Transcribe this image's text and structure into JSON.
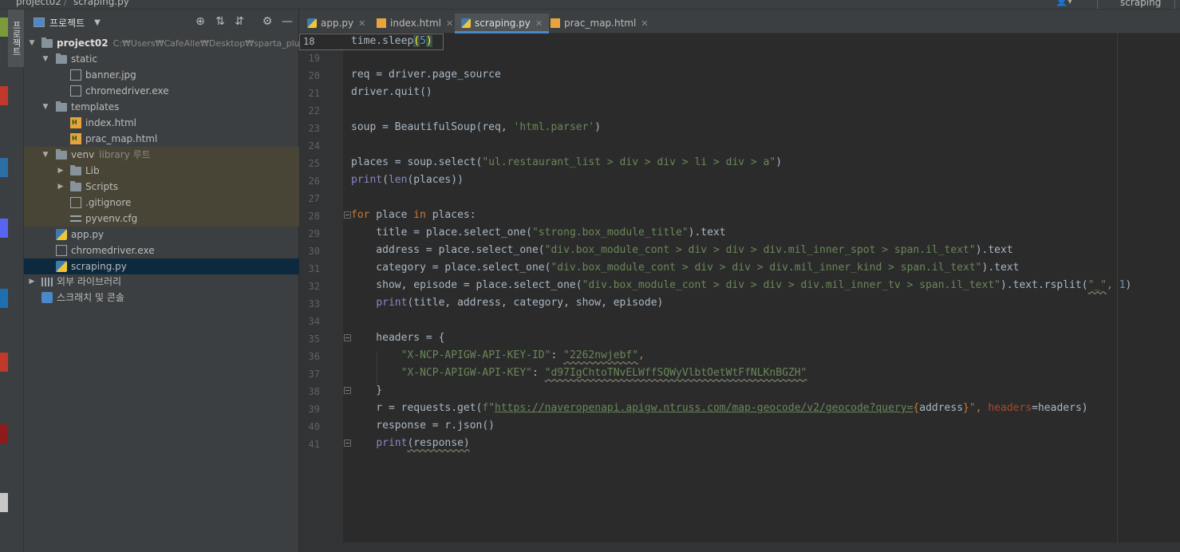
{
  "navbar": {
    "breadcrumb": [
      "project02",
      "scraping.py"
    ],
    "run_config": "scraping"
  },
  "project_panel": {
    "title": "프로젝트",
    "tree": [
      {
        "label": "project02",
        "hint": "C:₩Users₩CafeAlle₩Desktop₩sparta_plus₩pr"
      },
      {
        "label": "static"
      },
      {
        "label": "banner.jpg"
      },
      {
        "label": "chromedriver.exe"
      },
      {
        "label": "templates"
      },
      {
        "label": "index.html"
      },
      {
        "label": "prac_map.html"
      },
      {
        "label": "venv",
        "hint": "library 루트"
      },
      {
        "label": "Lib"
      },
      {
        "label": "Scripts"
      },
      {
        "label": ".gitignore"
      },
      {
        "label": "pyvenv.cfg"
      },
      {
        "label": "app.py"
      },
      {
        "label": "chromedriver.exe"
      },
      {
        "label": "scraping.py"
      },
      {
        "label": "외부 라이브러리"
      },
      {
        "label": "스크래치 및 콘솔"
      }
    ]
  },
  "tabs": [
    {
      "label": "app.py"
    },
    {
      "label": "index.html"
    },
    {
      "label": "scraping.py"
    },
    {
      "label": "prac_map.html"
    }
  ],
  "sticky": {
    "line": "18",
    "code_a": "time.sleep",
    "code_b": "(",
    "code_c": "5",
    "code_d": ")"
  },
  "line_numbers": [
    "19",
    "20",
    "21",
    "22",
    "23",
    "24",
    "25",
    "26",
    "27",
    "28",
    "29",
    "30",
    "31",
    "32",
    "33",
    "34",
    "35",
    "36",
    "37",
    "38",
    "39",
    "40",
    "41"
  ],
  "code": {
    "l20": "req = driver.page_source",
    "l21": "driver.quit()",
    "l23a": "soup = BeautifulSoup(req, ",
    "l23b": "'html.parser'",
    "l23c": ")",
    "l25a": "places = soup.select(",
    "l25b": "\"ul.restaurant_list > div > div > li > div > a\"",
    "l25c": ")",
    "l26a": "print",
    "l26b": "(",
    "l26c": "len",
    "l26d": "(places))",
    "l28a": "for",
    "l28b": " place ",
    "l28c": "in",
    "l28d": " places:",
    "l29a": "    title = place.select_one(",
    "l29b": "\"strong.box_module_title\"",
    "l29c": ").text",
    "l30a": "    address = place.select_one(",
    "l30b": "\"div.box_module_cont > div > div > div.mil_inner_spot > span.il_text\"",
    "l30c": ").text",
    "l31a": "    category = place.select_one(",
    "l31b": "\"div.box_module_cont > div > div > div.mil_inner_kind > span.il_text\"",
    "l31c": ").text",
    "l32a": "    show, episode = place.select_one(",
    "l32b": "\"div.box_module_cont > div > div > div.mil_inner_tv > span.il_text\"",
    "l32c": ").text.rsplit(",
    "l32d": "\"_\"",
    "l32e": ", ",
    "l32f": "1",
    "l32g": ")",
    "l33a": "    ",
    "l33b": "print",
    "l33c": "(title, address, category, show, episode)",
    "l35": "    headers = {",
    "l36a": "        ",
    "l36b": "\"X-NCP-APIGW-API-KEY-ID\"",
    "l36c": ": ",
    "l36d": "\"2262nwjebf\"",
    "l36e": ",",
    "l37a": "        ",
    "l37b": "\"X-NCP-APIGW-API-KEY\"",
    "l37c": ": ",
    "l37d": "\"d97IgChtoTNvELWffSQWyVlbtOetWtFfNLKnBGZH\"",
    "l38": "    }",
    "l39a": "    r = requests.get(",
    "l39b": "f\"",
    "l39c": "https://naveropenapi.apigw.ntruss.com/map-geocode/v2/geocode?query=",
    "l39d": "{",
    "l39e": "address",
    "l39f": "}",
    "l39g": "\"",
    "l39h": ", ",
    "l39i": "headers",
    "l39j": "=headers)",
    "l40": "    response = r.json()",
    "l41a": "    ",
    "l41b": "print",
    "l41c": "(response)"
  },
  "colors": {
    "keyword": "#cc7832",
    "string": "#6a8759",
    "builtin": "#8888c6",
    "number": "#6897bb",
    "default": "#a9b7c6",
    "selection": "#0d293e"
  }
}
